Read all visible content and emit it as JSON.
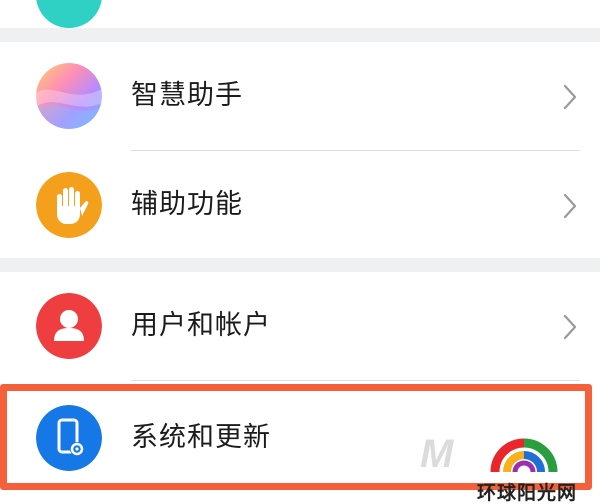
{
  "settings": {
    "items": [
      {
        "label": "智慧助手",
        "icon": "smart-assistant-gradient-icon"
      },
      {
        "label": "辅助功能",
        "icon": "hand-icon"
      },
      {
        "label": "用户和帐户",
        "icon": "user-icon"
      },
      {
        "label": "系统和更新",
        "icon": "phone-gear-icon"
      }
    ]
  },
  "colors": {
    "page_bg": "#eef0f2",
    "highlight_border": "#f4603a",
    "accessibility_orange": "#f5a01c",
    "user_red": "#ee3e40",
    "system_blue": "#1677e6",
    "teal_top": "#2ed1c4"
  },
  "watermark": {
    "text": "环球阳光网",
    "letter": "M"
  }
}
